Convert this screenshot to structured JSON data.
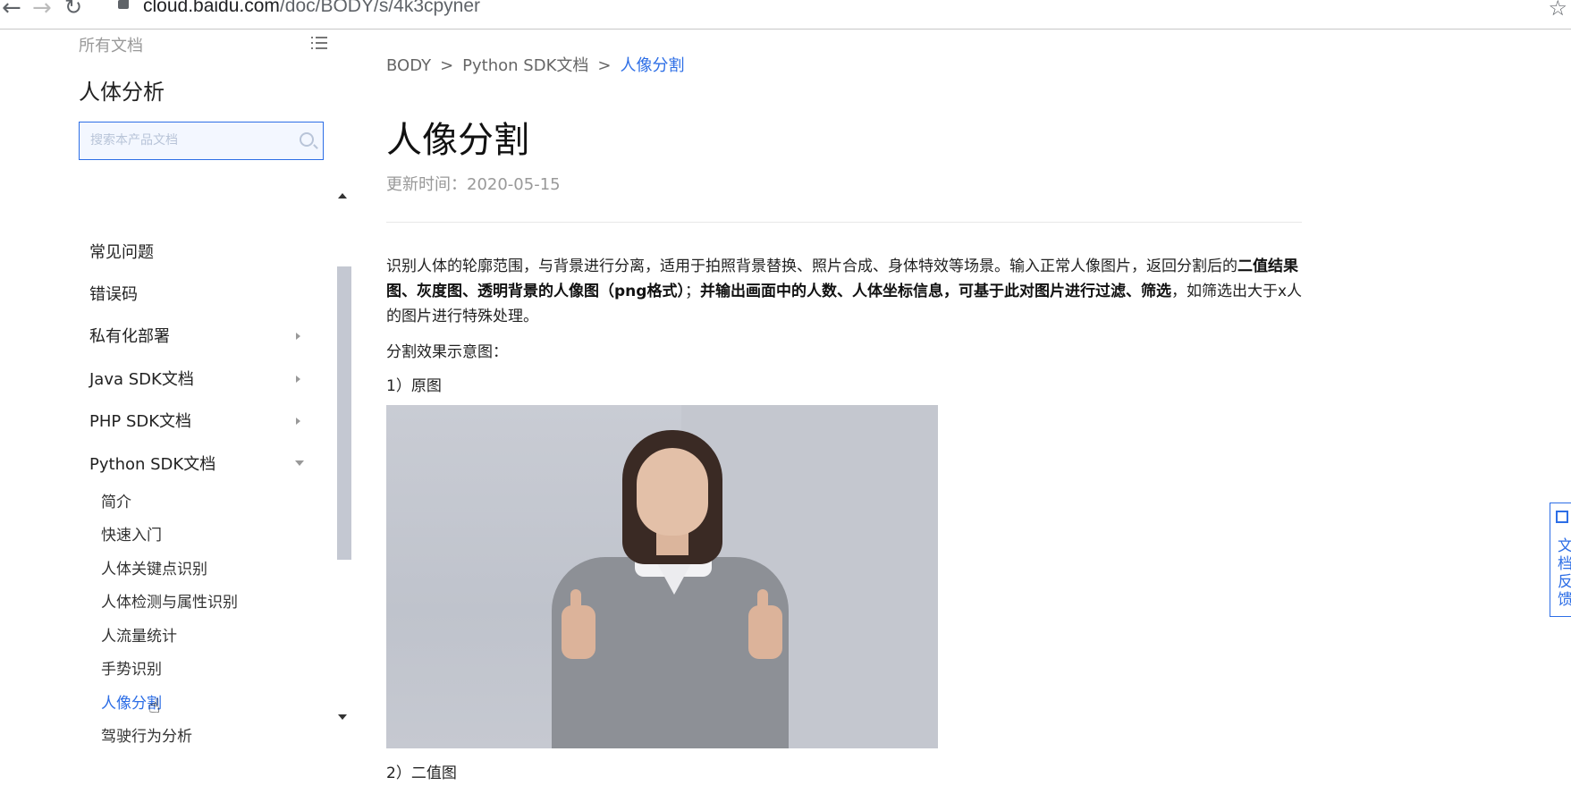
{
  "browser": {
    "url_host": "cloud.baidu.com",
    "url_path": "/doc/BODY/s/4k3cpyner"
  },
  "sidebar": {
    "all_docs_label": "所有文档",
    "product_title": "人体分析",
    "search_placeholder": "搜索本产品文档",
    "items": [
      {
        "label": "常见问题"
      },
      {
        "label": "错误码"
      },
      {
        "label": "私有化部署"
      },
      {
        "label": "Java SDK文档"
      },
      {
        "label": "PHP SDK文档"
      },
      {
        "label": "Python SDK文档"
      }
    ],
    "sub_items": [
      {
        "label": "简介"
      },
      {
        "label": "快速入门"
      },
      {
        "label": "人体关键点识别"
      },
      {
        "label": "人体检测与属性识别"
      },
      {
        "label": "人流量统计"
      },
      {
        "label": "手势识别"
      },
      {
        "label": "人像分割"
      },
      {
        "label": "驾驶行为分析"
      }
    ]
  },
  "breadcrumb": {
    "items": [
      "BODY",
      "Python SDK文档",
      "人像分割"
    ],
    "separator": ">"
  },
  "main": {
    "title": "人像分割",
    "update_label": "更新时间：",
    "update_date": "2020-05-15",
    "intro_part1": "识别人体的轮廓范围，与背景进行分离，适用于拍照背景替换、照片合成、身体特效等场景。输入正常人像图片，返回分割后的",
    "intro_bold1": "二值结果图、灰度图、透明背景的人像图（png格式）",
    "intro_part2": "；",
    "intro_bold2": "并输出画面中的人数、人体坐标信息，可基于此对图片进行过滤、筛选",
    "intro_part3": "，如筛选出大于x人的图片进行特殊处理。",
    "effect_label": "分割效果示意图：",
    "step1_label": "1）原图",
    "step2_label": "2）二值图"
  },
  "feedback": {
    "label": "文档反馈"
  },
  "colors": {
    "accent": "#2d6ee6",
    "muted": "#999999",
    "text": "#222222"
  }
}
